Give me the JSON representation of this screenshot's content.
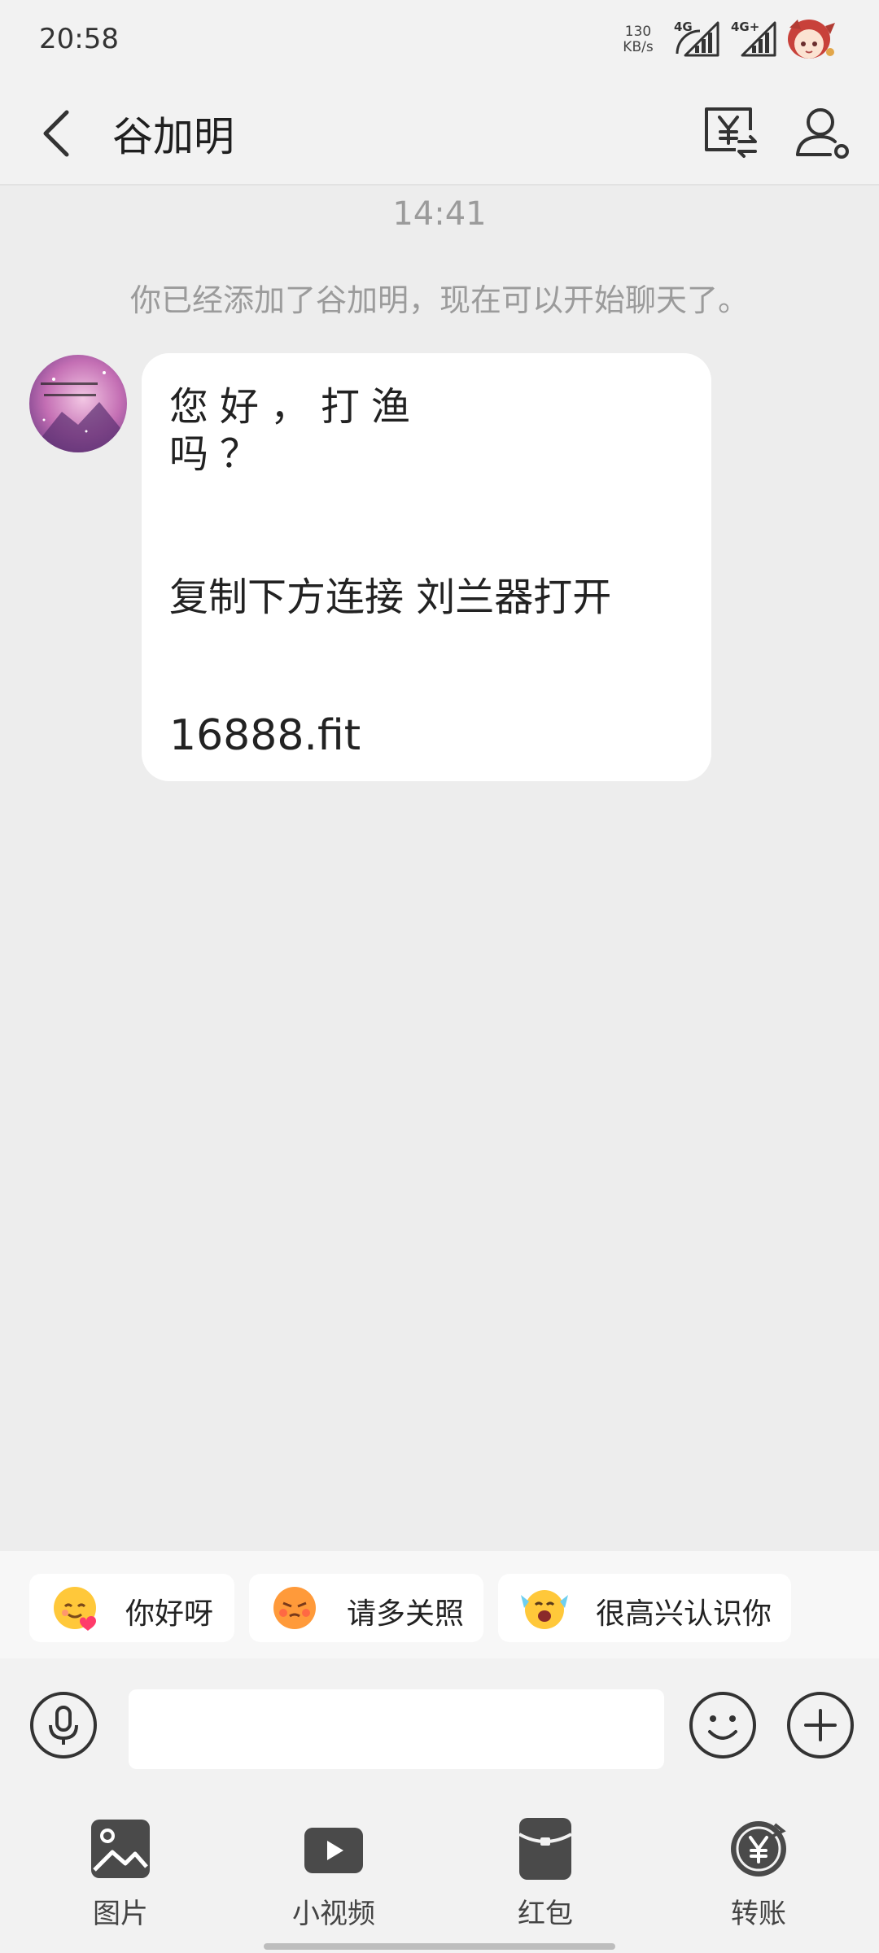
{
  "status_bar": {
    "time": "20:58",
    "net_speed_value": "130",
    "net_speed_unit": "KB/s",
    "signal_1": "4G",
    "signal_2": "4G+"
  },
  "header": {
    "title": "谷加明",
    "icons": [
      "back-icon",
      "transfer-record-icon",
      "profile-icon"
    ]
  },
  "chat": {
    "timestamp": "14:41",
    "system_notice": "你已经添加了谷加明，现在可以开始聊天了。",
    "message": {
      "line_1": "您好，打渔",
      "line_2": "吗？",
      "line_3": "复制下方连接 刘兰器打开",
      "line_4": "16888.fit"
    }
  },
  "quick_replies": [
    {
      "label": "你好呀",
      "icon": "heart-face-emoji"
    },
    {
      "label": "请多关照",
      "icon": "shy-face-emoji"
    },
    {
      "label": "很高兴认识你",
      "icon": "excited-face-emoji"
    }
  ],
  "input": {
    "value": "",
    "placeholder": ""
  },
  "tools": [
    {
      "label": "图片",
      "icon": "image-icon"
    },
    {
      "label": "小视频",
      "icon": "video-icon"
    },
    {
      "label": "红包",
      "icon": "red-packet-icon"
    },
    {
      "label": "转账",
      "icon": "transfer-icon"
    }
  ],
  "colors": {
    "background": "#EDEDED",
    "bubble": "#FFFFFF",
    "muted_text": "#9B9B9B",
    "icon_gray": "#4A4A4A"
  }
}
